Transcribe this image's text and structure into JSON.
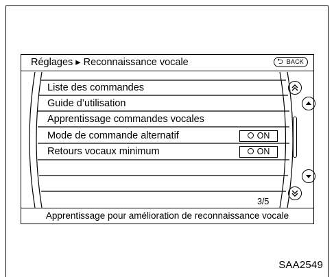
{
  "header": {
    "breadcrumb": "Réglages ▸ Reconnaissance vocale",
    "back_label": "BACK",
    "back_icon": "back-arrow-icon"
  },
  "menu": {
    "items": [
      {
        "label": "Liste des commandes"
      },
      {
        "label": "Guide d’utilisation"
      },
      {
        "label": "Apprentissage commandes vocales"
      },
      {
        "label": "Mode de commande alternatif",
        "toggle": "ON"
      },
      {
        "label": "Retours vocaux minimum",
        "toggle": "ON"
      }
    ],
    "page_counter": "3/5"
  },
  "footer": {
    "description": "Apprentissage pour amélioration de reconnaissance vocale"
  },
  "scroll": {
    "page_up_icon": "double-chevron-up-icon",
    "up_icon": "chevron-up-icon",
    "down_icon": "chevron-down-icon",
    "page_down_icon": "double-chevron-down-icon"
  },
  "figure_code": "SAA2549"
}
